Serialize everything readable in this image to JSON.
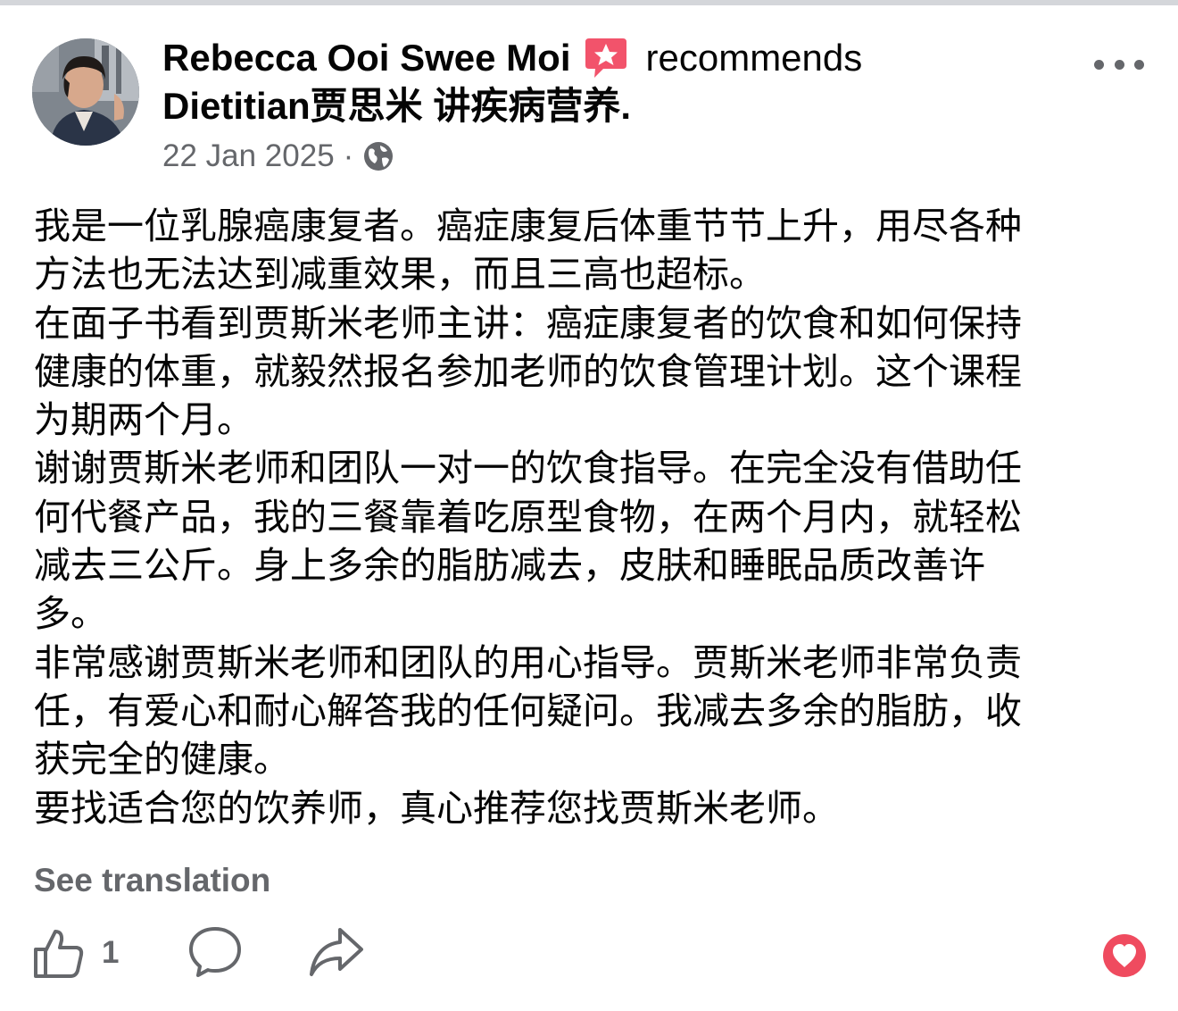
{
  "post": {
    "author": "Rebecca Ooi Swee Moi",
    "action": "recommends",
    "page_name": "Dietitian贾思米 讲疾病营养.",
    "date": "22 Jan 2025",
    "separator": "·",
    "privacy_icon": "globe-icon",
    "recommend_icon": "star-badge-icon",
    "more_icon": "more-options-icon",
    "body_lines": [
      "我是一位乳腺癌康复者。癌症康复后体重节节上升，用尽各种",
      "方法也无法达到减重效果，而且三高也超标。",
      "在面子书看到贾斯米老师主讲：癌症康复者的饮食和如何保持",
      "健康的体重，就毅然报名参加老师的饮食管理计划。这个课程",
      "为期两个月。",
      "谢谢贾斯米老师和团队一对一的饮食指导。在完全没有借助任",
      "何代餐产品，我的三餐靠着吃原型食物，在两个月内，就轻松",
      "减去三公斤。身上多余的脂肪减去，皮肤和睡眠品质改善许",
      "多。",
      "非常感谢贾斯米老师和团队的用心指导。贾斯米老师非常负责",
      "任，有爱心和耐心解答我的任何疑问。我减去多余的脂肪，收",
      "获完全的健康。",
      "要找适合您的饮养师，真心推荐您找贾斯米老师。"
    ],
    "see_translation": "See translation"
  },
  "actions": {
    "like_icon": "thumbs-up-icon",
    "like_count": "1",
    "comment_icon": "comment-icon",
    "share_icon": "share-icon",
    "reaction_icon": "heart-reaction-icon"
  },
  "colors": {
    "text_primary": "#050505",
    "text_secondary": "#65676b",
    "recommend_badge": "#f2536b",
    "heart_reaction": "#ef4b5f"
  }
}
